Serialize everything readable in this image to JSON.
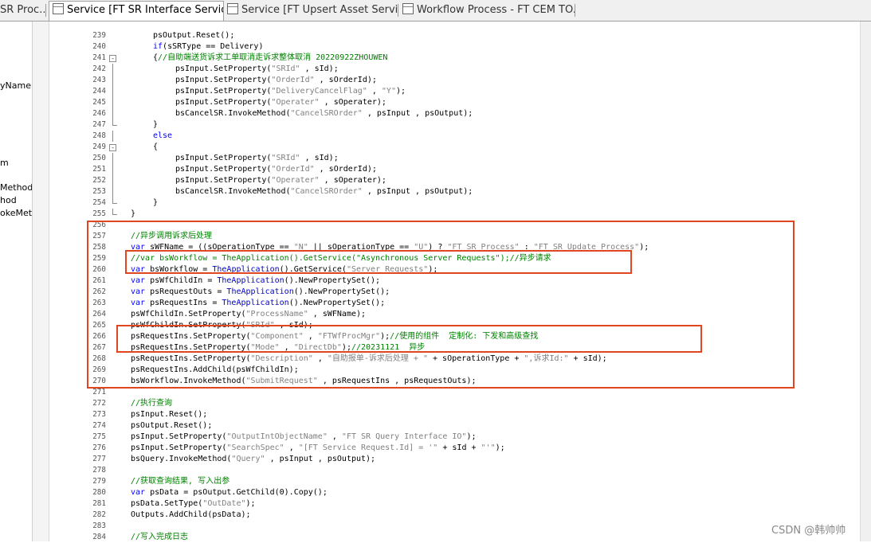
{
  "tabs": [
    {
      "label": "SR Proc..."
    },
    {
      "label": "Service [FT SR Interface Service..."
    },
    {
      "label": "Service [FT Upsert Asset Servic..."
    },
    {
      "label": "Workflow Process - FT CEM TO..."
    }
  ],
  "left_panel": {
    "items": [
      "yName",
      "m",
      "Method",
      "hod",
      "okeMetl"
    ]
  },
  "colors": {
    "keyword": "#0000ff",
    "string": "#808080",
    "comment": "#008000",
    "highlight_box": "#e0461f"
  },
  "code_lines": [
    {
      "num": "239",
      "text": "psOutput.Reset();"
    },
    {
      "num": "240",
      "text": "if(sSRType == Delivery)"
    },
    {
      "num": "241",
      "text": "{//自助端送货诉求工单取消走诉求整体取消 20220922ZHOUWEN"
    },
    {
      "num": "242",
      "text": "psInput.SetProperty(\"SRId\" , sId);"
    },
    {
      "num": "243",
      "text": "psInput.SetProperty(\"OrderId\" , sOrderId);"
    },
    {
      "num": "244",
      "text": "psInput.SetProperty(\"DeliveryCancelFlag\" , \"Y\");"
    },
    {
      "num": "245",
      "text": "psInput.SetProperty(\"Operater\" , sOperater);"
    },
    {
      "num": "246",
      "text": "bsCancelSR.InvokeMethod(\"CancelSROrder\" , psInput , psOutput);"
    },
    {
      "num": "247",
      "text": "}"
    },
    {
      "num": "248",
      "text": "else"
    },
    {
      "num": "249",
      "text": "{"
    },
    {
      "num": "250",
      "text": "psInput.SetProperty(\"SRId\" , sId);"
    },
    {
      "num": "251",
      "text": "psInput.SetProperty(\"OrderId\" , sOrderId);"
    },
    {
      "num": "252",
      "text": "psInput.SetProperty(\"Operater\" , sOperater);"
    },
    {
      "num": "253",
      "text": "bsCancelSR.InvokeMethod(\"CancelSROrder\" , psInput , psOutput);"
    },
    {
      "num": "254",
      "text": "}"
    },
    {
      "num": "255",
      "text": "}"
    },
    {
      "num": "256",
      "text": ""
    },
    {
      "num": "257",
      "text": "//异步调用诉求后处理"
    },
    {
      "num": "258",
      "text": "var sWFName = ((sOperationType == \"N\" || sOperationType == \"U\") ? \"FT SR Process\" : \"FT SR Update Process\");"
    },
    {
      "num": "259",
      "text": "//var bsWorkflow = TheApplication().GetService(\"Asynchronous Server Requests\");//异步请求"
    },
    {
      "num": "260",
      "text": "var bsWorkflow = TheApplication().GetService(\"Server Requests\");"
    },
    {
      "num": "261",
      "text": "var psWfChildIn = TheApplication().NewPropertySet();"
    },
    {
      "num": "262",
      "text": "var psRequestOuts = TheApplication().NewPropertySet();"
    },
    {
      "num": "263",
      "text": "var psRequestIns = TheApplication().NewPropertySet();"
    },
    {
      "num": "264",
      "text": "psWfChildIn.SetProperty(\"ProcessName\" , sWFName);"
    },
    {
      "num": "265",
      "text": "psWfChildIn.SetProperty(\"SRId\" , sId);"
    },
    {
      "num": "266",
      "text": "psRequestIns.SetProperty(\"Component\" , \"FTWfProcMgr\");//使用的组件  定制化: 下发和高级查找"
    },
    {
      "num": "267",
      "text": "psRequestIns.SetProperty(\"Mode\" , \"DirectDb\");//20231121  异步"
    },
    {
      "num": "268",
      "text": "psRequestIns.SetProperty(\"Description\" , \"自助报单-诉求后处理 + \" + sOperationType + \",诉求Id:\" + sId);"
    },
    {
      "num": "269",
      "text": "psRequestIns.AddChild(psWfChildIn);"
    },
    {
      "num": "270",
      "text": "bsWorkflow.InvokeMethod(\"SubmitRequest\" , psRequestIns , psRequestOuts);"
    },
    {
      "num": "271",
      "text": ""
    },
    {
      "num": "272",
      "text": "//执行查询"
    },
    {
      "num": "273",
      "text": "psInput.Reset();"
    },
    {
      "num": "274",
      "text": "psOutput.Reset();"
    },
    {
      "num": "275",
      "text": "psInput.SetProperty(\"OutputIntObjectName\" , \"FT SR Query Interface IO\");"
    },
    {
      "num": "276",
      "text": "psInput.SetProperty(\"SearchSpec\" , \"[FT Service Request.Id] = '\" + sId + \"'\");"
    },
    {
      "num": "277",
      "text": "bsQuery.InvokeMethod(\"Query\" , psInput , psOutput);"
    },
    {
      "num": "278",
      "text": ""
    },
    {
      "num": "279",
      "text": "//获取查询结果, 写入出参"
    },
    {
      "num": "280",
      "text": "var psData = psOutput.GetChild(0).Copy();"
    },
    {
      "num": "281",
      "text": "psData.SetType(\"OutDate\");"
    },
    {
      "num": "282",
      "text": "Outputs.AddChild(psData);"
    },
    {
      "num": "283",
      "text": ""
    },
    {
      "num": "284",
      "text": "//写入完成日志"
    }
  ],
  "watermark": "CSDN @韩帅帅"
}
